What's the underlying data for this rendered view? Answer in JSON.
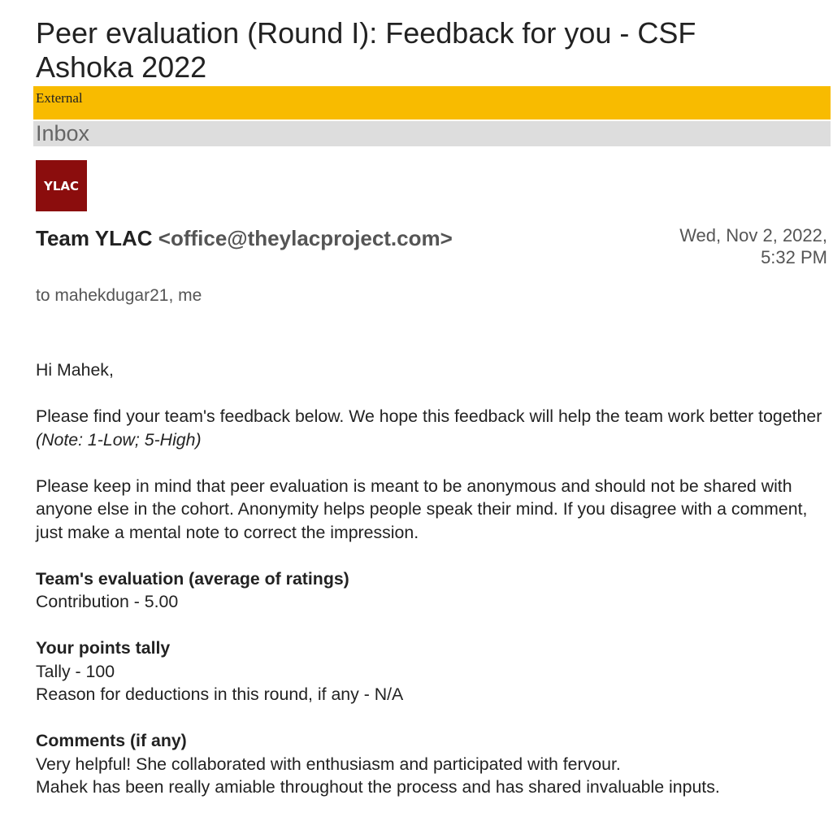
{
  "email": {
    "subject": "Peer evaluation (Round I): Feedback for you - CSF Ashoka 2022",
    "external_label": "External",
    "folder_label": "Inbox",
    "avatar_text": "YLAC",
    "sender_name": "Team YLAC",
    "sender_email": "<office@theylacproject.com>",
    "date_line1": "Wed, Nov 2, 2022,",
    "date_line2": "5:32 PM",
    "recipients": "to mahekdugar21, me"
  },
  "body": {
    "greeting": "Hi Mahek,",
    "intro_text": "Please find your team's feedback below. We hope this feedback will help the team work better together ",
    "intro_note": "(Note: 1-Low; 5-High)",
    "anonymity_text": "Please keep in mind that peer evaluation is meant to be anonymous and should not be shared with anyone else in the cohort. Anonymity helps people speak their mind. If you disagree with a comment, just make a mental note to correct the impression.",
    "evaluation_heading": "Team's evaluation (average of ratings)",
    "evaluation_value": "Contribution - 5.00",
    "tally_heading": "Your points tally",
    "tally_value": "Tally - 100",
    "deductions": "Reason for deductions in this round, if any - N/A",
    "comments_heading": "Comments (if any)",
    "comment_1": "Very helpful! She collaborated with enthusiasm and participated with fervour.",
    "comment_2": "Mahek has been really amiable throughout the process and has shared invaluable inputs."
  },
  "colors": {
    "external_bar": "#f8bb00",
    "inbox_bar": "#dddddd",
    "avatar_bg": "#8b0d0d",
    "text": "#222222",
    "muted": "#555555"
  }
}
